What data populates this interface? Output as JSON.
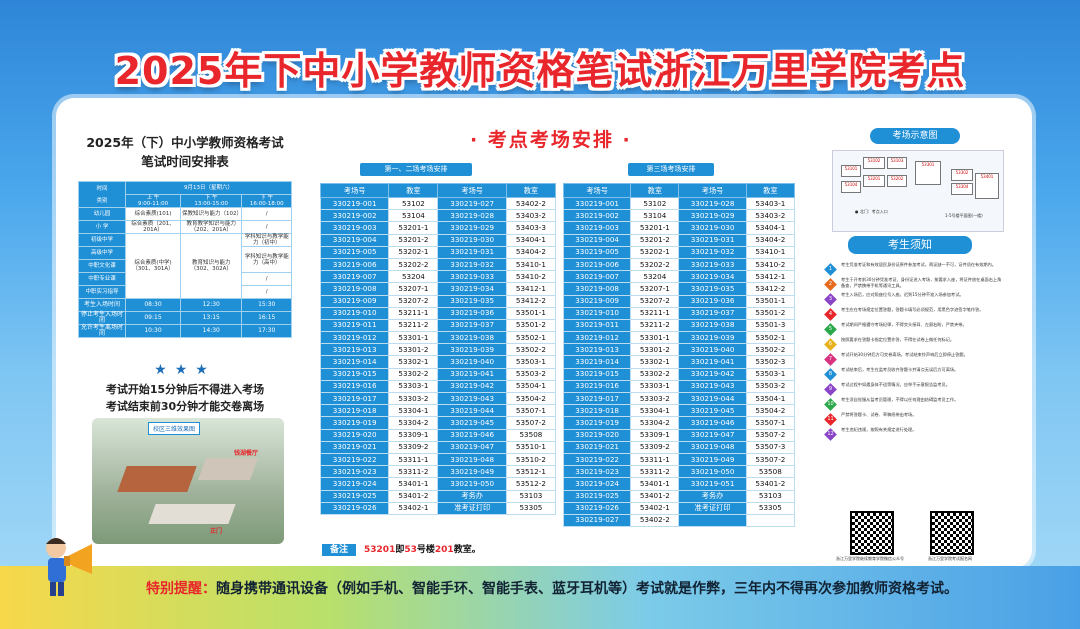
{
  "title": "2025年下中小学教师资格笔试浙江万里学院考点",
  "left": {
    "heading_line1": "2025年（下）中小学教师资格考试",
    "heading_line2": "笔试时间安排表",
    "schedule": {
      "corner_top": "时间",
      "corner_bottom": "类别",
      "date": "9月13日（星期六）",
      "slots": [
        {
          "name": "上  午",
          "time": "9:00-11:00"
        },
        {
          "name": "下  午",
          "time": "13:00-15:00"
        },
        {
          "name": "下  午",
          "time": "16:00-18:00"
        }
      ],
      "rows": [
        {
          "cat": "幼儿园",
          "s1": "综合素质(101)",
          "s2": "保教知识与能力（102）",
          "s3": "/"
        },
        {
          "cat": "小  学",
          "s1": "综合素质（201、201A）",
          "s2": "教育教学知识与能力（202、201A）",
          "s3": "/"
        },
        {
          "cat": "初级中学",
          "s1": "",
          "s2": "",
          "s3": "学科知识与教学能力（初中）"
        },
        {
          "cat": "高级中学",
          "s1": "",
          "s2": "",
          "s3": "学科知识与教学能力（高中）"
        },
        {
          "cat": "中职文化课",
          "s1": "综合素质(中学)（301、301A）",
          "s2": "教育知识与能力（302、302A）",
          "s3": ""
        },
        {
          "cat": "中职专业课",
          "s1": "",
          "s2": "",
          "s3": "/"
        },
        {
          "cat": "中职实习指导",
          "s1": "",
          "s2": "",
          "s3": "/"
        }
      ],
      "times": [
        {
          "label": "考生入场时间",
          "v1": "08:30",
          "v2": "12:30",
          "v3": "15:30"
        },
        {
          "label": "停止考生入场时间",
          "v1": "09:15",
          "v2": "13:15",
          "v3": "16:15"
        },
        {
          "label": "允许考生离场时间",
          "v1": "10:30",
          "v2": "14:30",
          "v3": "17:30"
        }
      ]
    },
    "stars": "★★★",
    "rule1": "考试开始15分钟后不得进入考场",
    "rule2": "考试结束前30分钟才能交卷离场",
    "campus_label": "校区三维效果图",
    "campus_tag1": "钱湖餐厅",
    "campus_tag2": "正门"
  },
  "middle": {
    "heading": "· 考点考场安排 ·",
    "ribbon1": "第一、二场考场安排",
    "ribbon2": "第三场考场安排",
    "col_id": "考场号",
    "col_room": "教室",
    "table1": [
      [
        "330219-001",
        "53102",
        "330219-027",
        "53402-2"
      ],
      [
        "330219-002",
        "53104",
        "330219-028",
        "53403-2"
      ],
      [
        "330219-003",
        "53201-1",
        "330219-029",
        "53403-3"
      ],
      [
        "330219-004",
        "53201-2",
        "330219-030",
        "53404-1"
      ],
      [
        "330219-005",
        "53202-1",
        "330219-031",
        "53404-2"
      ],
      [
        "330219-006",
        "53202-2",
        "330219-032",
        "53410-1"
      ],
      [
        "330219-007",
        "53204",
        "330219-033",
        "53410-2"
      ],
      [
        "330219-008",
        "53207-1",
        "330219-034",
        "53412-1"
      ],
      [
        "330219-009",
        "53207-2",
        "330219-035",
        "53412-2"
      ],
      [
        "330219-010",
        "53211-1",
        "330219-036",
        "53501-1"
      ],
      [
        "330219-011",
        "53211-2",
        "330219-037",
        "53501-2"
      ],
      [
        "330219-012",
        "53301-1",
        "330219-038",
        "53502-1"
      ],
      [
        "330219-013",
        "53301-2",
        "330219-039",
        "53502-2"
      ],
      [
        "330219-014",
        "53302-1",
        "330219-040",
        "53503-1"
      ],
      [
        "330219-015",
        "53302-2",
        "330219-041",
        "53503-2"
      ],
      [
        "330219-016",
        "53303-1",
        "330219-042",
        "53504-1"
      ],
      [
        "330219-017",
        "53303-2",
        "330219-043",
        "53504-2"
      ],
      [
        "330219-018",
        "53304-1",
        "330219-044",
        "53507-1"
      ],
      [
        "330219-019",
        "53304-2",
        "330219-045",
        "53507-2"
      ],
      [
        "330219-020",
        "53309-1",
        "330219-046",
        "53508"
      ],
      [
        "330219-021",
        "53309-2",
        "330219-047",
        "53510-1"
      ],
      [
        "330219-022",
        "53311-1",
        "330219-048",
        "53510-2"
      ],
      [
        "330219-023",
        "53311-2",
        "330219-049",
        "53512-1"
      ],
      [
        "330219-024",
        "53401-1",
        "330219-050",
        "53512-2"
      ],
      [
        "330219-025",
        "53401-2",
        "考务办",
        "53103"
      ],
      [
        "330219-026",
        "53402-1",
        "准考证打印",
        "53305"
      ]
    ],
    "table2": [
      [
        "330219-001",
        "53102",
        "330219-028",
        "53403-1"
      ],
      [
        "330219-002",
        "53104",
        "330219-029",
        "53403-2"
      ],
      [
        "330219-003",
        "53201-1",
        "330219-030",
        "53404-1"
      ],
      [
        "330219-004",
        "53201-2",
        "330219-031",
        "53404-2"
      ],
      [
        "330219-005",
        "53202-1",
        "330219-032",
        "53410-1"
      ],
      [
        "330219-006",
        "53202-2",
        "330219-033",
        "53410-2"
      ],
      [
        "330219-007",
        "53204",
        "330219-034",
        "53412-1"
      ],
      [
        "330219-008",
        "53207-1",
        "330219-035",
        "53412-2"
      ],
      [
        "330219-009",
        "53207-2",
        "330219-036",
        "53501-1"
      ],
      [
        "330219-010",
        "53211-1",
        "330219-037",
        "53501-2"
      ],
      [
        "330219-011",
        "53211-2",
        "330219-038",
        "53501-3"
      ],
      [
        "330219-012",
        "53301-1",
        "330219-039",
        "53502-1"
      ],
      [
        "330219-013",
        "53301-2",
        "330219-040",
        "53502-2"
      ],
      [
        "330219-014",
        "53302-1",
        "330219-041",
        "53502-3"
      ],
      [
        "330219-015",
        "53302-2",
        "330219-042",
        "53503-1"
      ],
      [
        "330219-016",
        "53303-1",
        "330219-043",
        "53503-2"
      ],
      [
        "330219-017",
        "53303-2",
        "330219-044",
        "53504-1"
      ],
      [
        "330219-018",
        "53304-1",
        "330219-045",
        "53504-2"
      ],
      [
        "330219-019",
        "53304-2",
        "330219-046",
        "53507-1"
      ],
      [
        "330219-020",
        "53309-1",
        "330219-047",
        "53507-2"
      ],
      [
        "330219-021",
        "53309-2",
        "330219-048",
        "53507-3"
      ],
      [
        "330219-022",
        "53311-1",
        "330219-049",
        "53507-2"
      ],
      [
        "330219-023",
        "53311-2",
        "330219-050",
        "53508"
      ],
      [
        "330219-024",
        "53401-1",
        "330219-051",
        "53401-2"
      ],
      [
        "330219-025",
        "53401-2",
        "考务办",
        "53103"
      ],
      [
        "330219-026",
        "53402-1",
        "准考证打印",
        "53305"
      ],
      [
        "330219-027",
        "53402-2",
        "",
        ""
      ]
    ],
    "note_label": "备注",
    "note_red1": "53201",
    "note_t1": "即",
    "note_red2": "53",
    "note_t2": "号楼",
    "note_red3": "201",
    "note_t3": "教室。"
  },
  "right": {
    "map_heading": "考场示意图",
    "map_rooms": [
      "53101",
      "53102",
      "53103",
      "53104",
      "53201",
      "53202",
      "53301",
      "53302",
      "53304",
      "53401"
    ],
    "map_cap1": "● 北门：考点入口",
    "map_cap2": "1-5号楼平面图(一楼)",
    "req_heading": "考生须知",
    "req_colors": [
      "#1f8fd6",
      "#e86a1f",
      "#8a44c8",
      "#e8262b",
      "#2aa84a",
      "#e8b21f",
      "#d8337f",
      "#1f8fd6",
      "#8a44c8",
      "#2aa84a",
      "#e8262b",
      "#8a44c8"
    ],
    "reqs": [
      "考生凭准考证和有效居民身份证原件参加考试，两证缺一不可，证件须在有效期内。",
      "考生于开考前30分钟凭准考证、身份证进入考场，按要求入座，将证件放在桌面右上角备查，严禁携带手机等通讯工具。",
      "考生入场后，应对照座位号入座。迟到15分钟不准入场参加考试。",
      "考生应在考场规定位置答题，答题卡填写必须规范，用黑色字迹签字笔作答。",
      "考试期间严格遵守考场纪律，不得交头接耳、左顾右盼，严禁夹带。",
      "按照要求在答题卡指定位置作答，不得在试卷上做任何标记。",
      "考试开始30分钟后方可交卷离场，考试结束铃声响后立即停止答题。",
      "考试结束后，考生在监考员收齐答题卡并清点无误后方可离场。",
      "考试过程中如遇身体不适等情况，应举手示意报告监考员。",
      "考生须自觉服从监考员管理，不得以任何理由妨碍监考员工作。",
      "严禁将答题卡、试卷、草稿纸带出考场。",
      "考生违纪违规，按照有关规定进行处理。"
    ],
    "qr_cap1": "浙江万里学院继续教育学院微信公众号",
    "qr_cap2": "浙江万里学院考试报名网"
  },
  "notice_label": "特别提醒：",
  "notice_text": "随身携带通讯设备（例如手机、智能手环、智能手表、蓝牙耳机等）考试就是作弊，三年内不得再次参加教师资格考试。"
}
